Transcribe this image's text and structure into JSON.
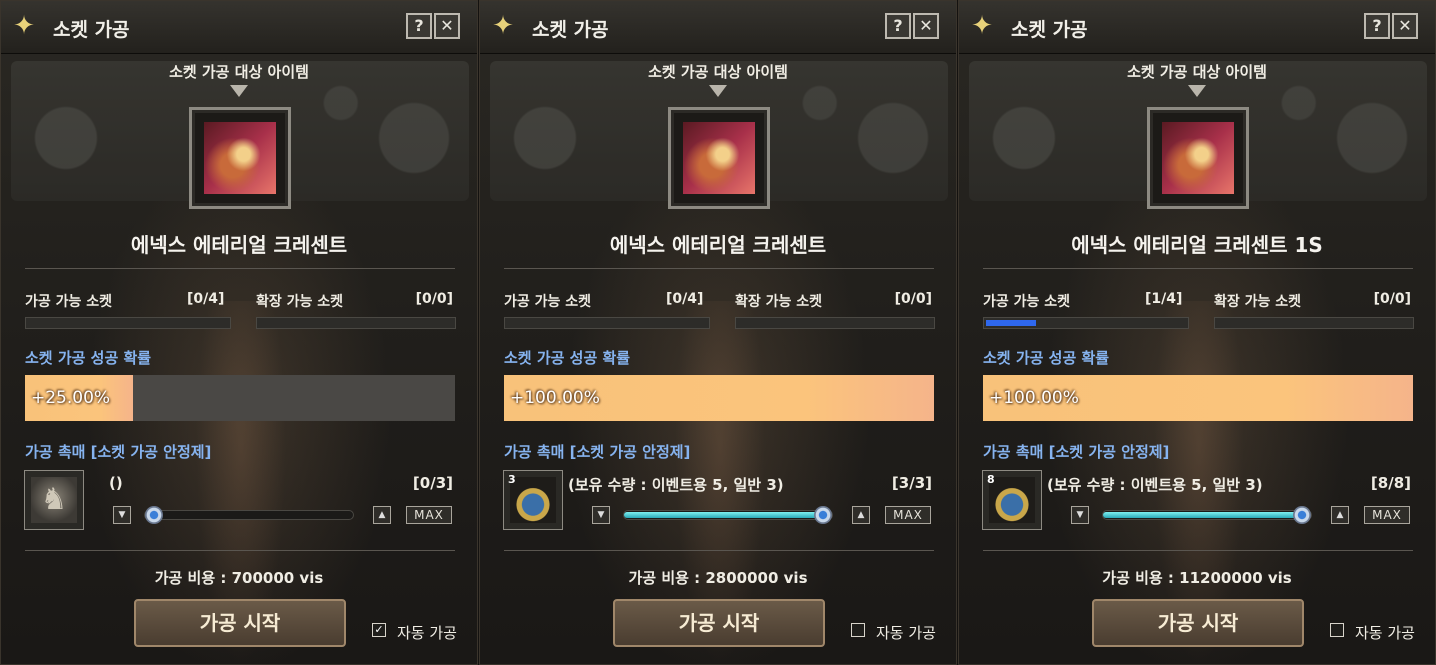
{
  "panels": [
    {
      "title": "소켓 가공",
      "help_label": "?",
      "close_label": "✕",
      "target_label": "소켓 가공 대상 아이템",
      "item_name": "에넥스 에테리얼 크레센트",
      "processable_label": "가공 가능 소켓",
      "processable_value": "[0/4]",
      "processable_fraction": 0.0,
      "expandable_label": "확장 가능 소켓",
      "expandable_value": "[0/0]",
      "success_title": "소켓 가공 성공 확률",
      "success_rate_text": "+25.00%",
      "success_rate_percent": 25,
      "catalyst_title": "가공 촉매 [소켓 가공 안정제]",
      "catalyst_icon": "lion-emblem-icon",
      "catalyst_badge": "",
      "catalyst_text": "()",
      "catalyst_count": "[0/3]",
      "slider_fraction": 0.0,
      "down_label": "▼",
      "up_label": "▲",
      "max_label": "MAX",
      "cost": "가공 비용 : 700000 vis",
      "start_label": "가공 시작",
      "auto_checked": true,
      "auto_mark": "✓",
      "auto_label": "자동 가공"
    },
    {
      "title": "소켓 가공",
      "help_label": "?",
      "close_label": "✕",
      "target_label": "소켓 가공 대상 아이템",
      "item_name": "에넥스 에테리얼 크레센트",
      "processable_label": "가공 가능 소켓",
      "processable_value": "[0/4]",
      "processable_fraction": 0.0,
      "expandable_label": "확장 가능 소켓",
      "expandable_value": "[0/0]",
      "success_title": "소켓 가공 성공 확률",
      "success_rate_text": "+100.00%",
      "success_rate_percent": 100,
      "catalyst_title": "가공 촉매 [소켓 가공 안정제]",
      "catalyst_icon": "pouch-icon",
      "catalyst_badge": "3",
      "catalyst_text": "(보유 수량 : 이벤트용 5, 일반 3)",
      "catalyst_count": "[3/3]",
      "slider_fraction": 1.0,
      "down_label": "▼",
      "up_label": "▲",
      "max_label": "MAX",
      "cost": "가공 비용 : 2800000 vis",
      "start_label": "가공 시작",
      "auto_checked": false,
      "auto_mark": "",
      "auto_label": "자동 가공"
    },
    {
      "title": "소켓 가공",
      "help_label": "?",
      "close_label": "✕",
      "target_label": "소켓 가공 대상 아이템",
      "item_name": "에넥스 에테리얼 크레센트 1S",
      "processable_label": "가공 가능 소켓",
      "processable_value": "[1/4]",
      "processable_fraction": 0.25,
      "expandable_label": "확장 가능 소켓",
      "expandable_value": "[0/0]",
      "success_title": "소켓 가공 성공 확률",
      "success_rate_text": "+100.00%",
      "success_rate_percent": 100,
      "catalyst_title": "가공 촉매 [소켓 가공 안정제]",
      "catalyst_icon": "pouch-icon",
      "catalyst_badge": "8",
      "catalyst_text": "(보유 수량 : 이벤트용 5, 일반 3)",
      "catalyst_count": "[8/8]",
      "slider_fraction": 1.0,
      "down_label": "▼",
      "up_label": "▲",
      "max_label": "MAX",
      "cost": "가공 비용 : 11200000 vis",
      "start_label": "가공 시작",
      "auto_checked": false,
      "auto_mark": "",
      "auto_label": "자동 가공"
    }
  ],
  "colors": {
    "section_title": "#86b3ef",
    "rate_fill": "#fbc47c",
    "socket_fill": "#2f68ee",
    "slider_fill": "#5fd8e0"
  }
}
